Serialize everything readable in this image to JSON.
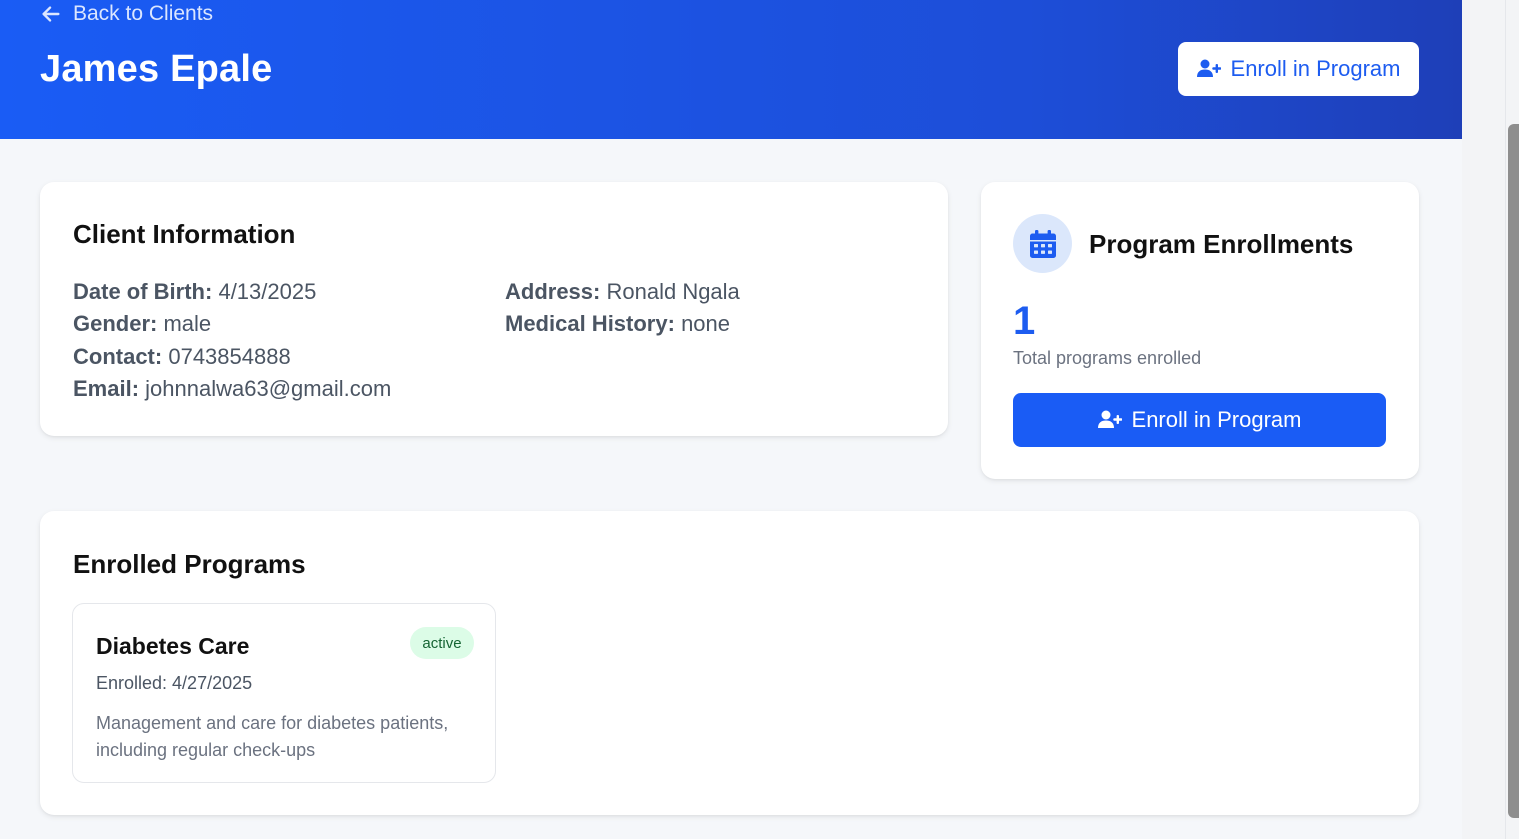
{
  "header": {
    "back_label": "Back to Clients",
    "client_name": "James Epale",
    "enroll_button_label": "Enroll in Program"
  },
  "client_info": {
    "title": "Client Information",
    "fields": {
      "dob": {
        "label": "Date of Birth:",
        "value": "4/13/2025"
      },
      "gender": {
        "label": "Gender:",
        "value": "male"
      },
      "contact": {
        "label": "Contact:",
        "value": "0743854888"
      },
      "email": {
        "label": "Email:",
        "value": "johnnalwa63@gmail.com"
      },
      "address": {
        "label": "Address:",
        "value": "Ronald Ngala"
      },
      "medical_history": {
        "label": "Medical History:",
        "value": "none"
      }
    }
  },
  "enrollments_summary": {
    "title": "Program Enrollments",
    "icon": "calendar-icon",
    "count": "1",
    "caption": "Total programs enrolled",
    "button_label": "Enroll in Program"
  },
  "enrolled_programs": {
    "title": "Enrolled Programs",
    "items": [
      {
        "name": "Diabetes Care",
        "status": "active",
        "enrolled": "Enrolled: 4/27/2025",
        "description": "Management and care for diabetes patients, including regular check-ups"
      }
    ]
  },
  "colors": {
    "primary": "#1a5cf5",
    "header_gradient_end": "#1e3fb8",
    "badge_bg": "#dcfce7",
    "badge_text": "#166534"
  }
}
